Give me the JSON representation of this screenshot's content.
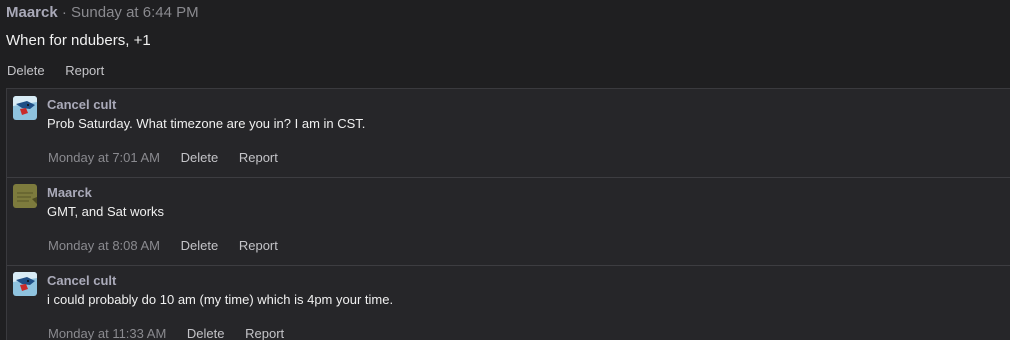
{
  "post": {
    "author": "Maarck",
    "separator": "·",
    "time": "Sunday at 6:44 PM",
    "body": "When for ndubers, +1",
    "actions": {
      "delete": "Delete",
      "report": "Report"
    }
  },
  "replies": [
    {
      "author": "Cancel cult",
      "avatar_icon": "bird-avatar-icon",
      "text": "Prob Saturday. What timezone are you in? I am in CST.",
      "time": "Monday at 7:01 AM",
      "delete": "Delete",
      "report": "Report"
    },
    {
      "author": "Maarck",
      "avatar_icon": "olive-avatar-icon",
      "text": "GMT, and Sat works",
      "time": "Monday at 8:08 AM",
      "delete": "Delete",
      "report": "Report"
    },
    {
      "author": "Cancel cult",
      "avatar_icon": "bird-avatar-icon",
      "text": "i could probably do 10 am (my time) which is 4pm your time.",
      "time": "Monday at 11:33 AM",
      "delete": "Delete",
      "report": "Report"
    }
  ],
  "colors": {
    "background": "#1f1f21",
    "replies_background": "#262629",
    "author": "#a9a9b8",
    "muted": "#8a8a8f",
    "text": "#f0f0f0"
  }
}
